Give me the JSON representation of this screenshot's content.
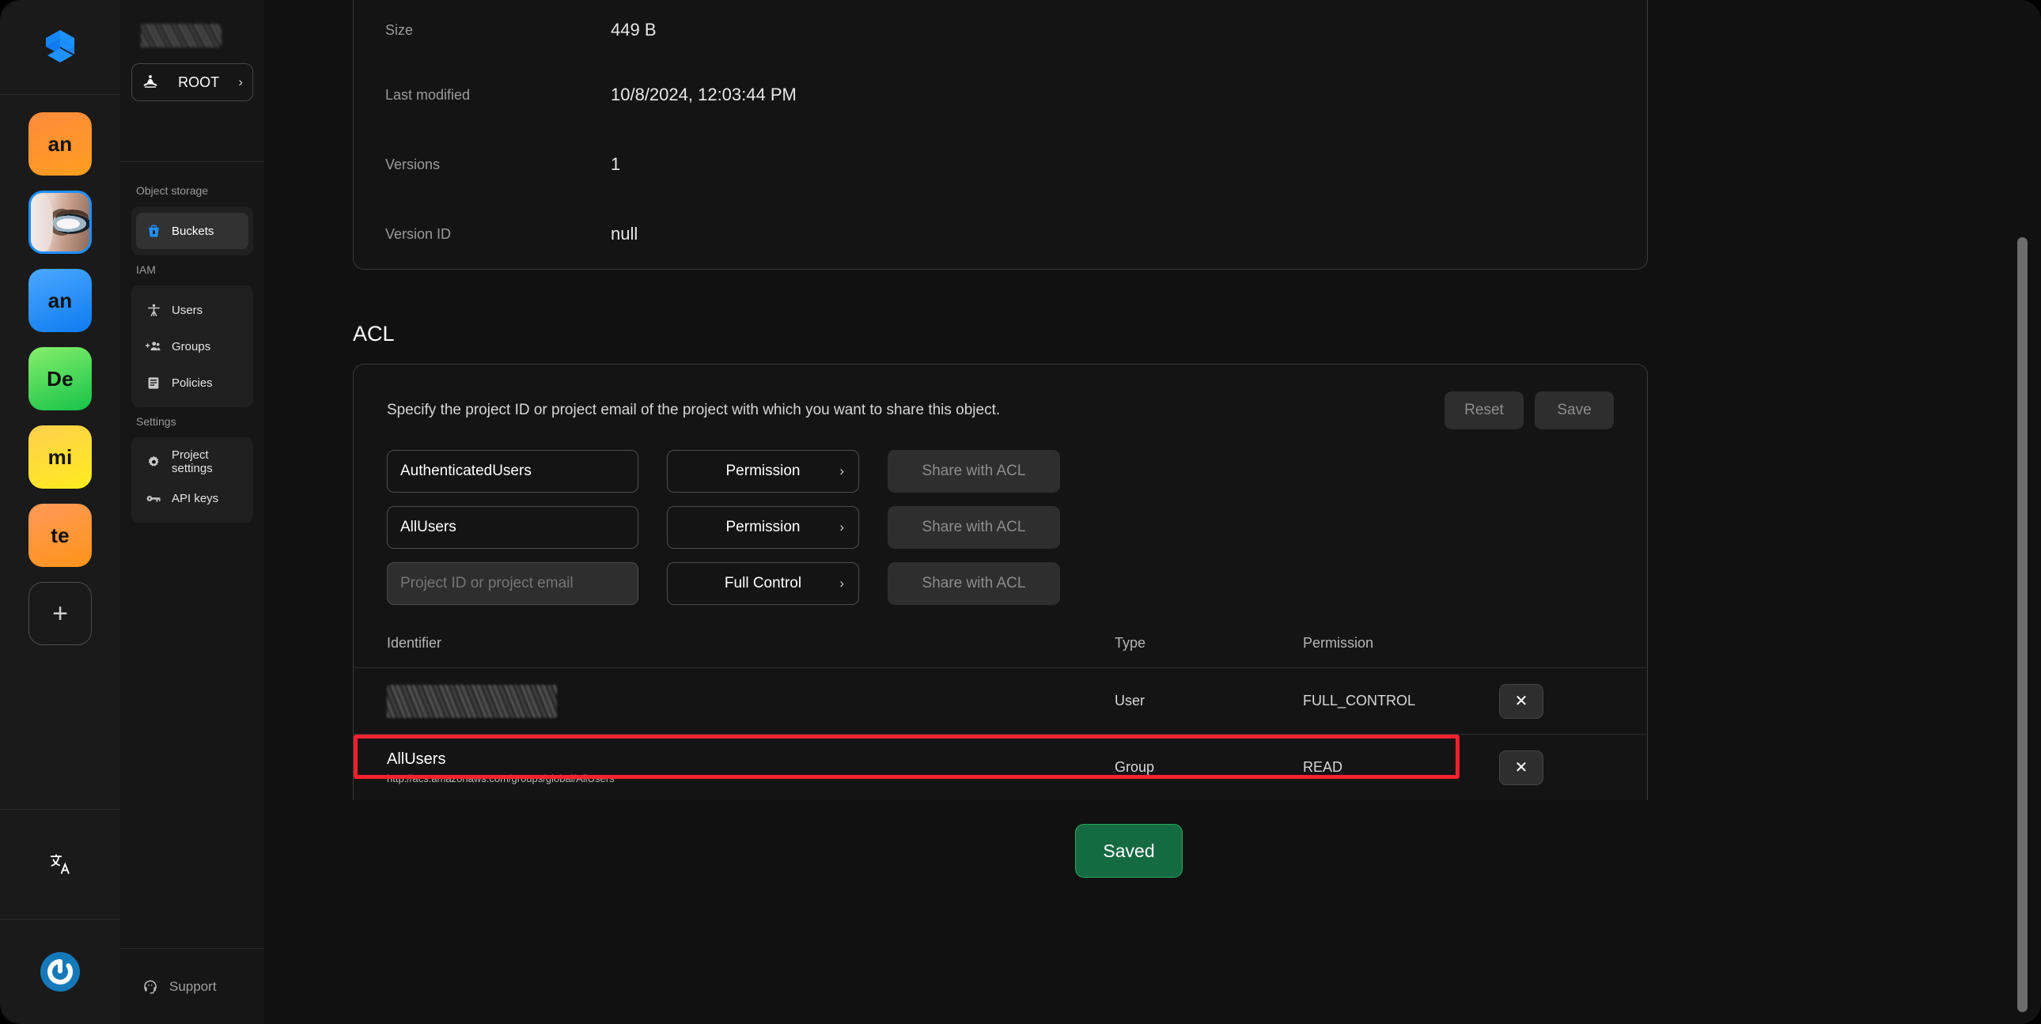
{
  "app": {
    "brand_icon": "cube-logo-icon",
    "accent": "#1e90ff",
    "highlight_color": "#f8212f",
    "saved_color": "#156b41"
  },
  "rail": {
    "tiles": [
      {
        "label": "an",
        "style": "orange",
        "name": "workspace-tile-an-orange"
      },
      {
        "label": "",
        "style": "photo",
        "name": "workspace-tile-avatar-photo"
      },
      {
        "label": "an",
        "style": "blue",
        "name": "workspace-tile-an-blue"
      },
      {
        "label": "De",
        "style": "green",
        "name": "workspace-tile-de"
      },
      {
        "label": "mi",
        "style": "yellow",
        "name": "workspace-tile-mi"
      },
      {
        "label": "te",
        "style": "orange2",
        "name": "workspace-tile-te"
      }
    ],
    "add_label": "+",
    "language_icon": "translate-icon",
    "account_icon": "power-avatar-icon"
  },
  "sidebar": {
    "project_button": {
      "label": "ROOT",
      "icon": "meditation-icon",
      "chevron": "›"
    },
    "sections": [
      {
        "title": "Object storage",
        "items": [
          {
            "label": "Buckets",
            "icon": "bucket-icon",
            "active": true
          }
        ]
      },
      {
        "title": "IAM",
        "items": [
          {
            "label": "Users",
            "icon": "user-icon",
            "active": false
          },
          {
            "label": "Groups",
            "icon": "groups-icon",
            "active": false
          },
          {
            "label": "Policies",
            "icon": "policy-icon",
            "active": false
          }
        ]
      },
      {
        "title": "Settings",
        "items": [
          {
            "label": "Project settings",
            "icon": "gear-icon",
            "active": false
          },
          {
            "label": "API keys",
            "icon": "key-icon",
            "active": false
          }
        ]
      }
    ],
    "support": {
      "label": "Support",
      "icon": "headset-icon"
    }
  },
  "details": {
    "rows": [
      {
        "key": "Size",
        "value": "449 B"
      },
      {
        "key": "Last modified",
        "value": "10/8/2024, 12:03:44 PM"
      },
      {
        "key": "Versions",
        "value": "1"
      },
      {
        "key": "Version ID",
        "value": "null"
      }
    ]
  },
  "acl": {
    "title": "ACL",
    "description": "Specify the project ID or project email of the project with which you want to share this object.",
    "reset_label": "Reset",
    "save_label": "Save",
    "share_label": "Share with ACL",
    "rows": [
      {
        "identifier": "AuthenticatedUsers",
        "is_placeholder": false,
        "permission": "Permission"
      },
      {
        "identifier": "AllUsers",
        "is_placeholder": false,
        "permission": "Permission"
      },
      {
        "identifier": "Project ID or project email",
        "is_placeholder": true,
        "permission": "Full Control"
      }
    ],
    "table": {
      "columns": [
        "Identifier",
        "Type",
        "Permission"
      ],
      "rows": [
        {
          "identifier": "",
          "identifier_redacted": true,
          "identifier_sub": "",
          "type": "User",
          "permission": "FULL_CONTROL",
          "highlighted": false,
          "remove_label": "✕"
        },
        {
          "identifier": "AllUsers",
          "identifier_redacted": false,
          "identifier_sub": "http://acs.amazonaws.com/groups/global/AllUsers",
          "type": "Group",
          "permission": "READ",
          "highlighted": true,
          "remove_label": "✕"
        }
      ]
    },
    "saved_button": "Saved"
  }
}
